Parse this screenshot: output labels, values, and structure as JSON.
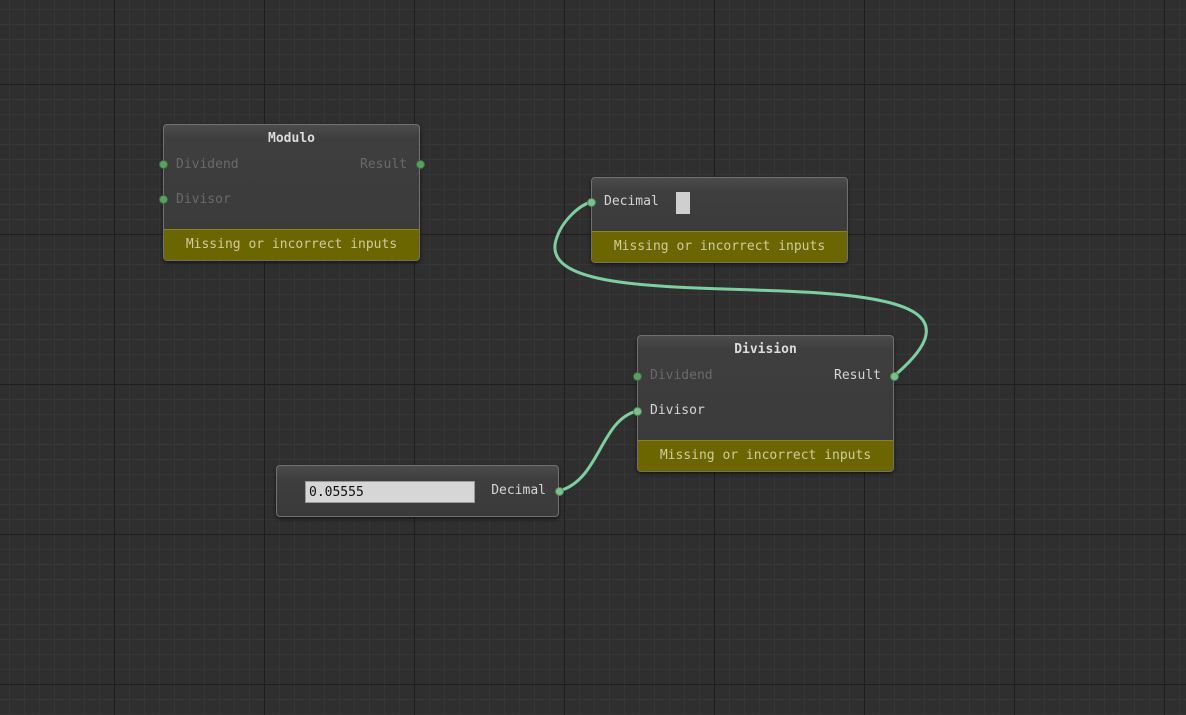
{
  "colors": {
    "background": "#2f2f2f",
    "wire": "#7dcfa0",
    "status_bar": "#6b6600",
    "port": "#5aa060"
  },
  "nodes": {
    "modulo": {
      "title": "Modulo",
      "inputs": [
        "Dividend",
        "Divisor"
      ],
      "output": "Result",
      "status": "Missing or incorrect inputs"
    },
    "decimal_top": {
      "input": "Decimal",
      "status": "Missing or incorrect inputs"
    },
    "division": {
      "title": "Division",
      "inputs": [
        "Dividend",
        "Divisor"
      ],
      "output": "Result",
      "status": "Missing or incorrect inputs"
    },
    "decimal_bottom": {
      "value": "0.05555",
      "output": "Decimal"
    }
  }
}
